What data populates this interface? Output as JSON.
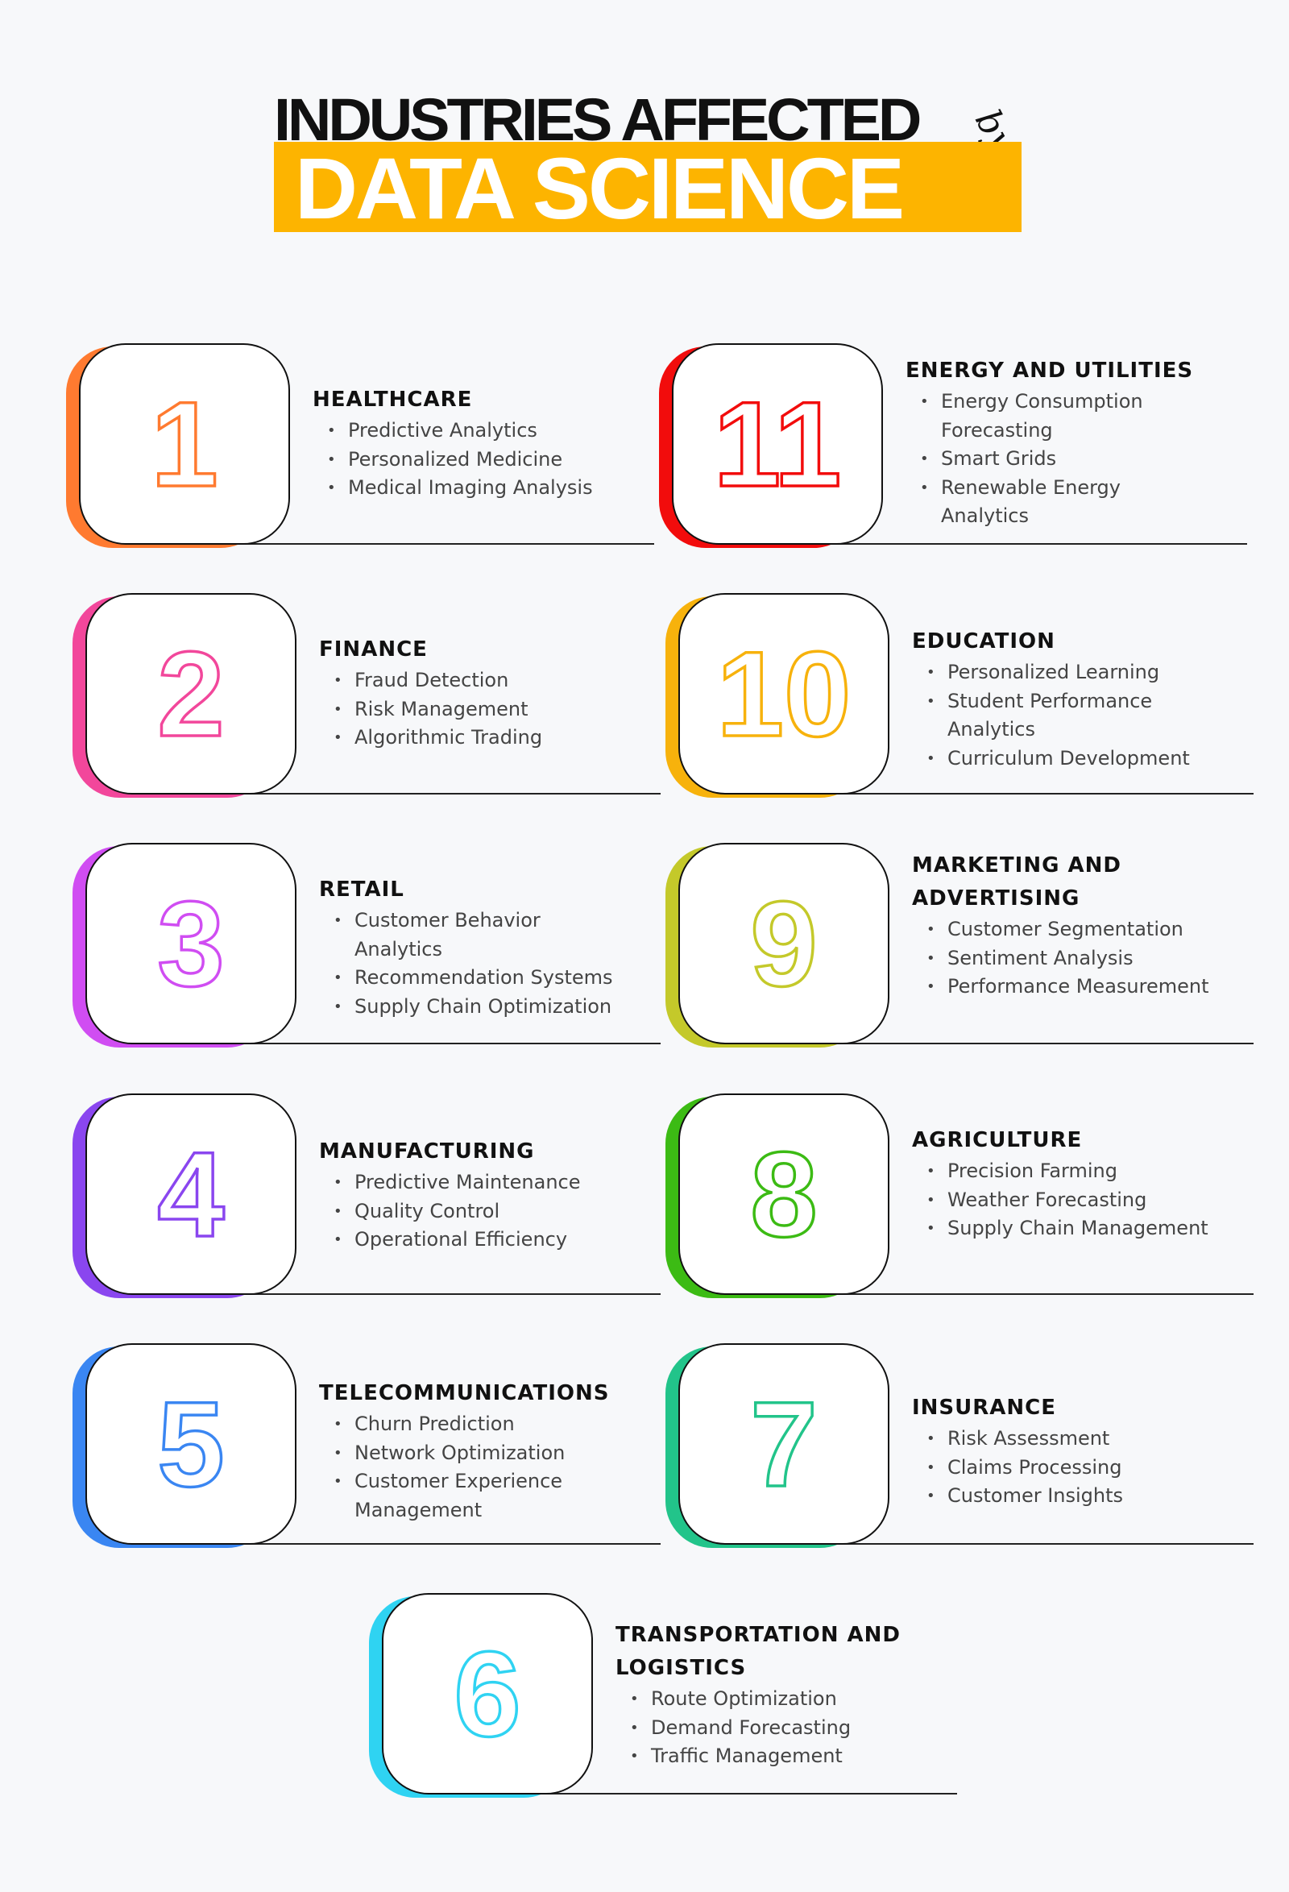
{
  "title": {
    "line1": "INDUSTRIES AFFECTED",
    "by": "by",
    "line2": "DATA SCIENCE",
    "band_color": "#fdb400"
  },
  "industries": [
    {
      "number": "1",
      "name": "HEALTHCARE",
      "color": "#ff7a30",
      "items": [
        "Predictive Analytics",
        "Personalized Medicine",
        "Medical Imaging Analysis"
      ]
    },
    {
      "number": "2",
      "name": "FINANCE",
      "color": "#f2479b",
      "items": [
        "Fraud Detection",
        "Risk Management",
        "Algorithmic Trading"
      ]
    },
    {
      "number": "3",
      "name": "RETAIL",
      "color": "#d04df2",
      "items": [
        "Customer Behavior Analytics",
        "Recommendation Systems",
        "Supply Chain Optimization"
      ]
    },
    {
      "number": "4",
      "name": "MANUFACTURING",
      "color": "#8a46ef",
      "items": [
        "Predictive Maintenance",
        "Quality Control",
        "Operational Efficiency"
      ]
    },
    {
      "number": "5",
      "name": "TELECOMMUNICATIONS",
      "color": "#3a86f2",
      "items": [
        "Churn Prediction",
        "Network Optimization",
        "Customer Experience Management"
      ]
    },
    {
      "number": "6",
      "name": "TRANSPORTATION AND LOGISTICS",
      "color": "#2fd3f2",
      "items": [
        "Route Optimization",
        "Demand Forecasting",
        "Traffic Management"
      ]
    },
    {
      "number": "7",
      "name": "INSURANCE",
      "color": "#22c48a",
      "items": [
        "Risk Assessment",
        "Claims Processing",
        "Customer Insights"
      ]
    },
    {
      "number": "8",
      "name": "AGRICULTURE",
      "color": "#3cbb14",
      "items": [
        "Precision Farming",
        "Weather Forecasting",
        "Supply Chain Management"
      ]
    },
    {
      "number": "9",
      "name": "MARKETING AND ADVERTISING",
      "color": "#c4c92a",
      "items": [
        "Customer Segmentation",
        "Sentiment Analysis",
        "Performance Measurement"
      ]
    },
    {
      "number": "10",
      "name": "EDUCATION",
      "color": "#f7b20c",
      "items": [
        "Personalized Learning",
        "Student Performance Analytics",
        "Curriculum Development"
      ]
    },
    {
      "number": "11",
      "name": "ENERGY AND UTILITIES",
      "color": "#f20c0c",
      "items": [
        "Energy Consumption Forecasting",
        "Smart Grids",
        "Renewable Energy Analytics"
      ]
    }
  ]
}
